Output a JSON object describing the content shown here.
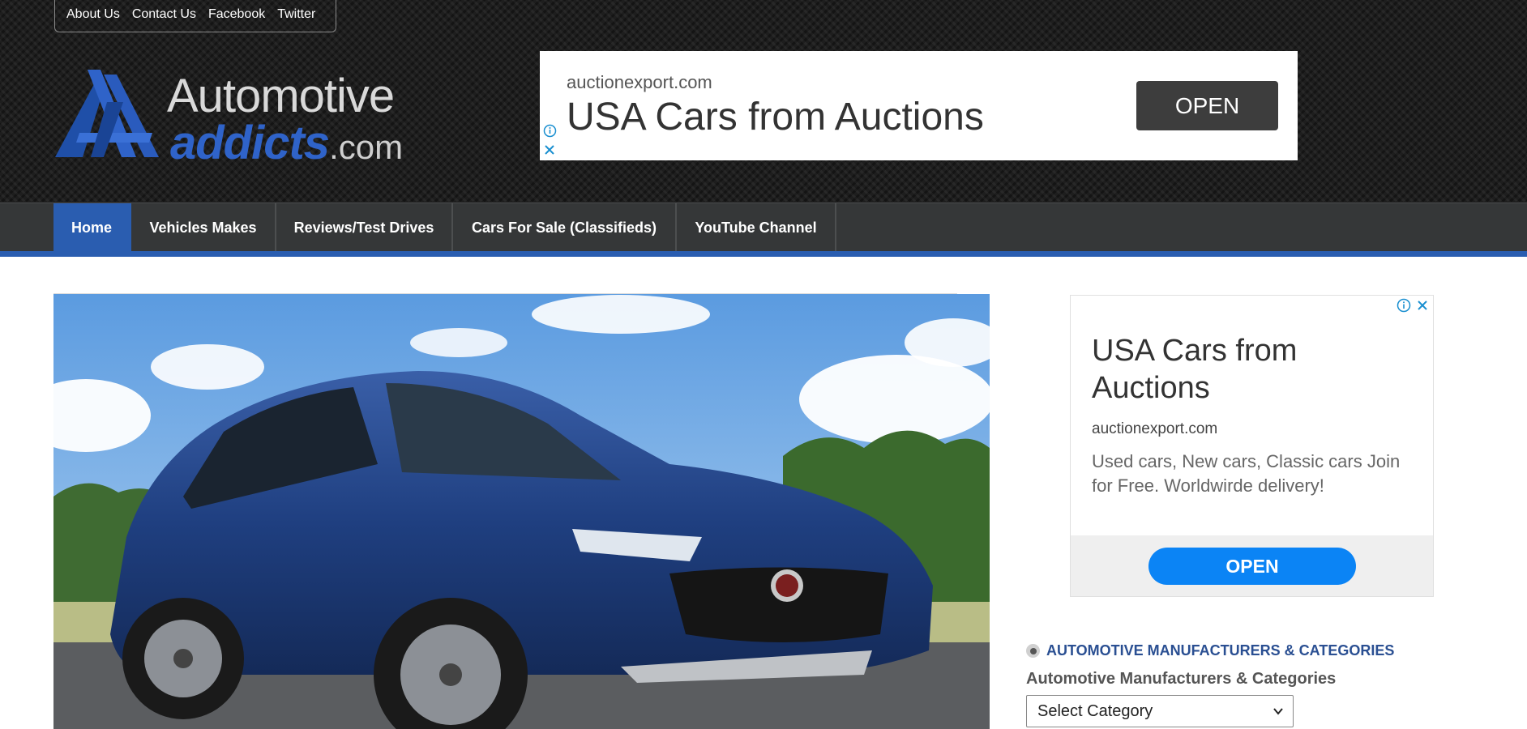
{
  "topnav": {
    "links": [
      "About Us",
      "Contact Us",
      "Facebook",
      "Twitter"
    ]
  },
  "logo": {
    "word1": "Automotive",
    "word2": "addicts",
    "suffix": ".com"
  },
  "header_ad": {
    "domain": "auctionexport.com",
    "headline": "USA Cars from Auctions",
    "button": "OPEN",
    "info_icon": "info-icon",
    "close_icon": "close-icon"
  },
  "mainnav": {
    "items": [
      {
        "label": "Home",
        "active": true
      },
      {
        "label": "Vehicles Makes",
        "active": false
      },
      {
        "label": "Reviews/Test Drives",
        "active": false
      },
      {
        "label": "Cars For Sale (Classifieds)",
        "active": false
      },
      {
        "label": "YouTube Channel",
        "active": false
      }
    ]
  },
  "sidebar_ad": {
    "headline": "USA Cars from Auctions",
    "domain": "auctionexport.com",
    "description": "Used cars, New cars, Classic cars Join for Free. Worldwirde delivery!",
    "button": "OPEN"
  },
  "widget": {
    "title": "AUTOMOTIVE MANUFACTURERS & CATEGORIES",
    "label": "Automotive Manufacturers & Categories",
    "select_value": "Select Category"
  },
  "colors": {
    "accent": "#2a5db0",
    "nav_bg": "#353738",
    "ad_button": "#0b84f5",
    "widget_title": "#2a4f92"
  }
}
